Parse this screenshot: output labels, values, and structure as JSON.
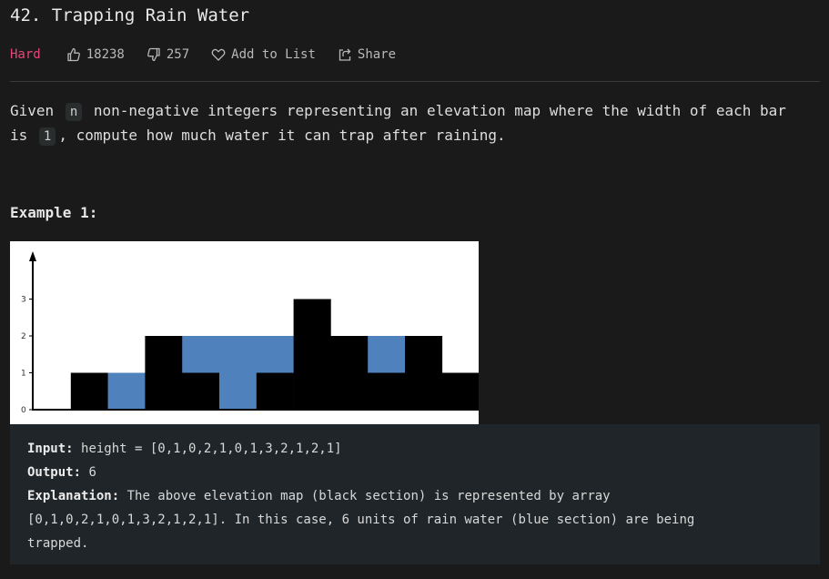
{
  "problem": {
    "title": "42. Trapping Rain Water",
    "difficulty": "Hard",
    "likes": "18238",
    "dislikes": "257",
    "add_to_list": "Add to List",
    "share": "Share"
  },
  "description": {
    "part1": "Given",
    "code_n": "n",
    "part2": "non-negative integers representing an elevation map where the width of each bar is",
    "code_1": "1",
    "part3": ", compute how much water it can trap after raining."
  },
  "example": {
    "heading": "Example 1:",
    "input_label": "Input:",
    "input_value": "height = [0,1,0,2,1,0,1,3,2,1,2,1]",
    "output_label": "Output:",
    "output_value": "6",
    "explanation_label": "Explanation:",
    "explanation_line1": "The above elevation map (black section) is represented by array",
    "explanation_line2": "[0,1,0,2,1,0,1,3,2,1,2,1]. In this case, 6 units of rain water (blue section) are being",
    "explanation_line3": "trapped."
  },
  "chart_data": {
    "type": "bar",
    "categories": [
      "",
      "",
      "",
      "",
      "",
      "",
      "",
      "",
      "",
      "",
      "",
      ""
    ],
    "series": [
      {
        "values": [
          0,
          1,
          0,
          2,
          1,
          0,
          1,
          3,
          2,
          1,
          2,
          1
        ]
      },
      {
        "values": [
          0,
          0,
          1,
          0,
          1,
          2,
          1,
          0,
          0,
          1,
          0,
          0
        ]
      }
    ],
    "y_ticks": [
      "0",
      "1",
      "2",
      "3"
    ],
    "ylim": [
      0,
      3
    ],
    "colors": {
      "bar": "#000000",
      "water": "#4f81bd"
    },
    "grid": false
  }
}
